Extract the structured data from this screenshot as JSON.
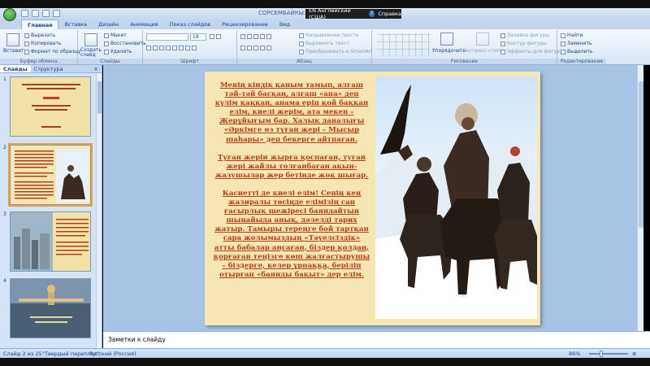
{
  "window": {
    "title": "СОРСЕМБАЙКЫЗ А"
  },
  "language_bar": {
    "language": "EN Английский (США)",
    "help": "Справка"
  },
  "ribbon_tabs": [
    "Главная",
    "Вставка",
    "Дизайн",
    "Анимация",
    "Показ слайдов",
    "Рецензирование",
    "Вид"
  ],
  "ribbon": {
    "clipboard": {
      "paste": "Вставить",
      "cut": "Вырезать",
      "copy": "Копировать",
      "format_painter": "Формат по образцу",
      "label": "Буфер обмена"
    },
    "slides": {
      "new_slide": "Создать слайд",
      "layout": "Макет",
      "reset": "Восстановить",
      "delete": "Удалить",
      "label": "Слайды"
    },
    "font": {
      "size": "18",
      "label": "Шрифт"
    },
    "paragraph": {
      "text_direction": "Направление текста",
      "align_text": "Выровнять текст",
      "smartart": "Преобразовать в SmartArt",
      "label": "Абзац"
    },
    "drawing": {
      "arrange": "Упорядочить",
      "quick_styles": "Экспресс-стили",
      "fill": "Заливка фигуры",
      "outline": "Контур фигуры",
      "effects": "Эффекты для фигур",
      "label": "Рисование"
    },
    "editing": {
      "find": "Найти",
      "replace": "Заменить",
      "select": "Выделить",
      "label": "Редактирование"
    }
  },
  "panel": {
    "tabs": [
      "Слайды",
      "Структура"
    ],
    "close": "×",
    "slide_numbers": [
      "1",
      "2",
      "3",
      "4"
    ]
  },
  "slide": {
    "paragraphs": [
      "Менің кіндік қаным тамып, алғаш тәй-тәй басқан, алғаш «ана» деп күлім қаққан, анама еріп қой баққан елім, киелі жерім, ата мекен – Жерұйығым бар. Халық даналығы «Әркімге өз туған жері – Мысыр шаһары» деп бекерге айтпаған.",
      "Туған жерін жырға қоспаған, туған жері жайлы толғанбаған ақын-жазушылар жер бетінде жоқ шығар.",
      "Қасиетті де киелі елім! Сенің кең жазиралы төсіңде елімізің сан ғасырлық шежіресі баяндайтын шыңайыда анық, дәлелді тарих жатыр. Тамыры тереңге бой тартқан сара жолымыздың «Тәуелсіздік» атты бабалар аңсаған, біздер қолдан, қорғаған теңізге көш жалғастырушы – біздерге, келер ұрпаққа, беріліп отырған «баянды бақыт» дер елім."
    ]
  },
  "notes": {
    "placeholder": "Заметки к слайду"
  },
  "status": {
    "slide": "Слайд 2 из 25",
    "theme": "\"Твердый переплет\"",
    "language": "Русский (Россия)",
    "zoom": "86%"
  },
  "colors": {
    "accent": "#15428b",
    "slide_bg": "#f5e6b4",
    "slide_text": "#b23c14"
  }
}
